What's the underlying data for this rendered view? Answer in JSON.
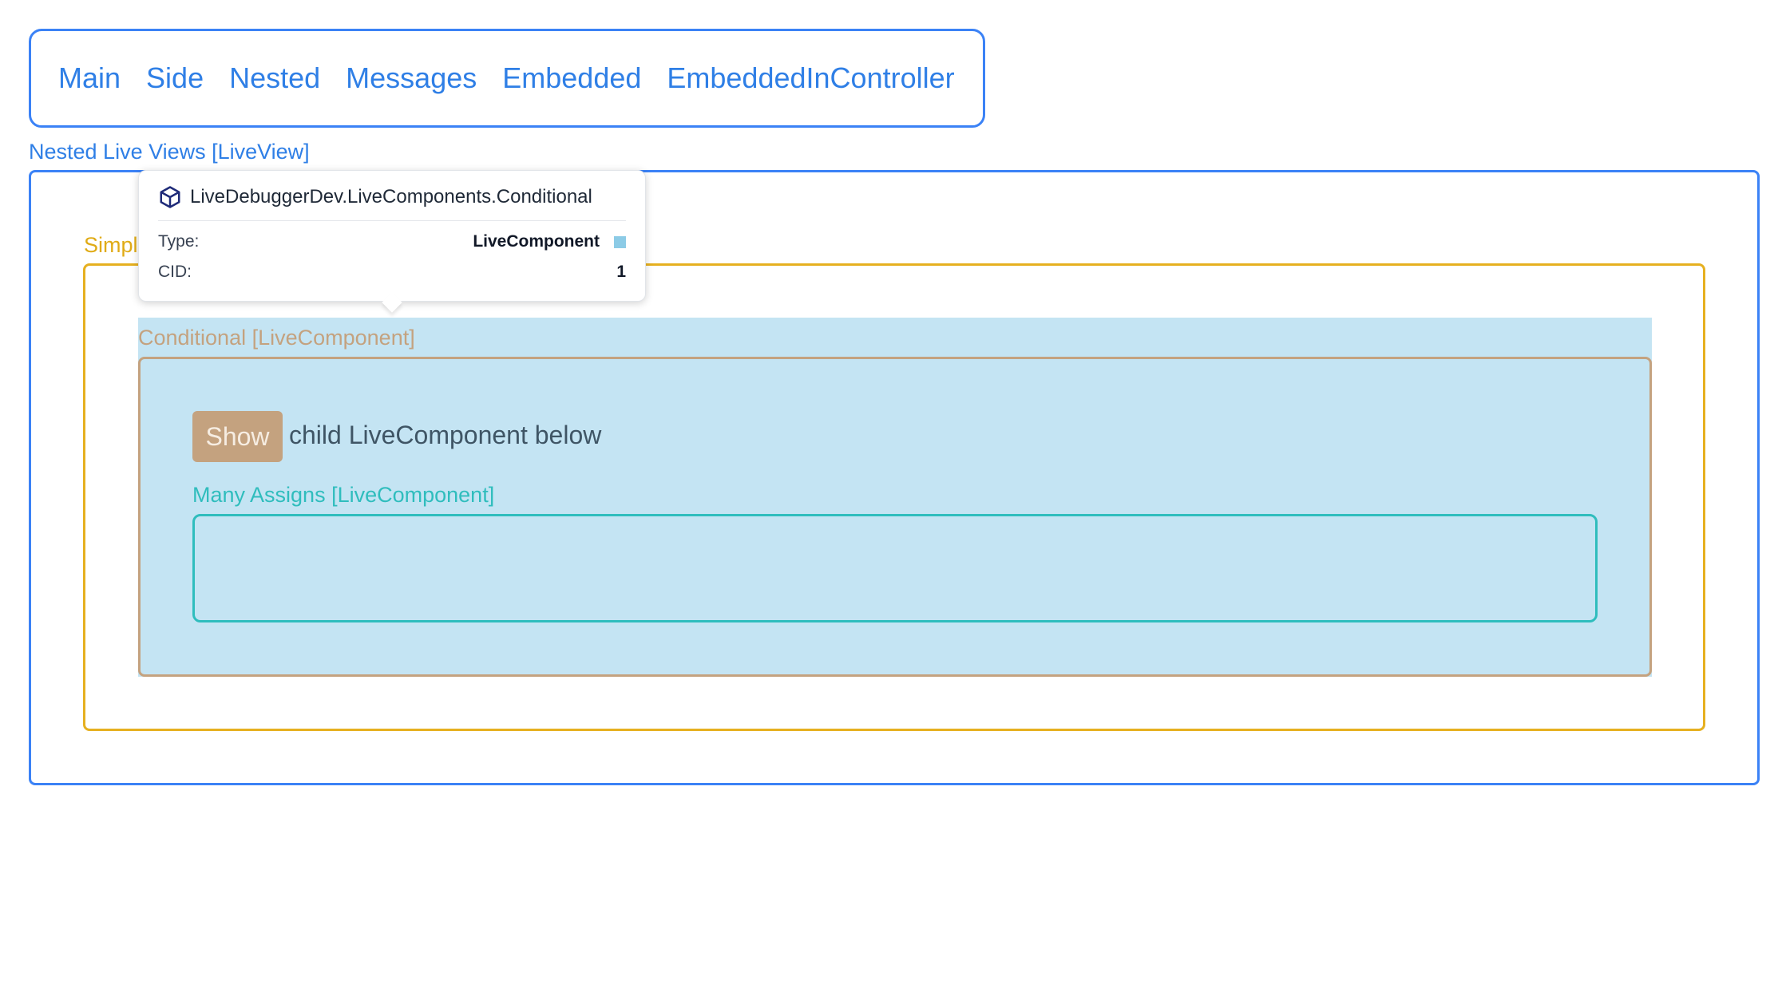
{
  "nav": {
    "links": [
      "Main",
      "Side",
      "Nested",
      "Messages",
      "Embedded",
      "EmbeddedInController"
    ]
  },
  "live_view": {
    "label": "Nested Live Views [LiveView]"
  },
  "simple": {
    "label": "Simpl"
  },
  "conditional": {
    "label": "Conditional [LiveComponent]",
    "show_button": "Show",
    "child_text": "child LiveComponent below"
  },
  "many_assigns": {
    "label": "Many Assigns [LiveComponent]"
  },
  "tooltip": {
    "icon": "cube-icon",
    "title": "LiveDebuggerDev.LiveComponents.Conditional",
    "type_key": "Type:",
    "type_value": "LiveComponent",
    "cid_key": "CID:",
    "cid_value": "1",
    "swatch_color": "#8ccbe6"
  },
  "colors": {
    "liveview": "#3b82f6",
    "simple": "#e6b020",
    "conditional": "#c4a27f",
    "many_assigns": "#2fbdbd",
    "highlight": "#c4e4f3"
  }
}
